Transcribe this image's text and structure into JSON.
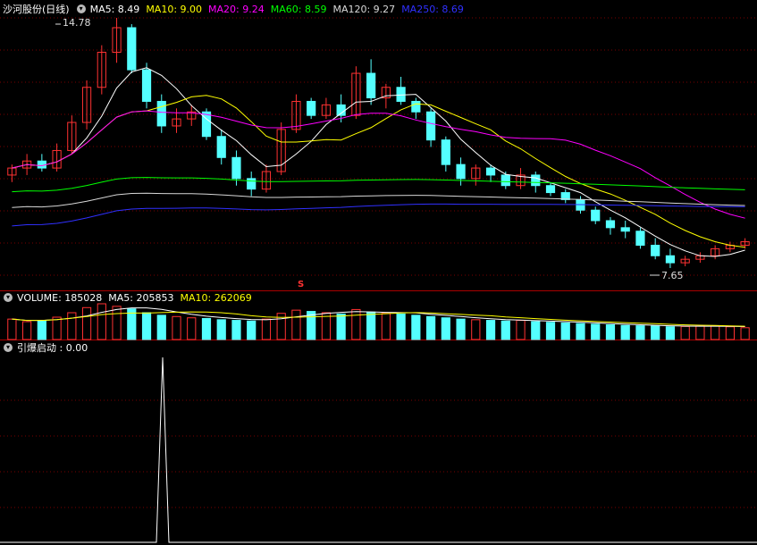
{
  "stock_title": "沙河股份(日线)",
  "ma_legend": [
    {
      "label": "MA5: 8.49",
      "color": "#ffffff"
    },
    {
      "label": "MA10: 9.00",
      "color": "#ffff00"
    },
    {
      "label": "MA20: 9.24",
      "color": "#ff00ff"
    },
    {
      "label": "MA60: 8.59",
      "color": "#00ff00"
    },
    {
      "label": "MA120: 9.27",
      "color": "#d8d8d8"
    },
    {
      "label": "MA250: 8.69",
      "color": "#3030ff"
    }
  ],
  "volume_legend": {
    "volume": "VOLUME: 185028",
    "ma5": "MA5: 205853",
    "ma10": "MA10: 262069",
    "ma5_color": "#ffffff",
    "ma10_color": "#ffff00"
  },
  "indicator_legend": {
    "label": "引爆启动 : 0.00"
  },
  "high_label": "14.78",
  "low_label": "7.65",
  "marker_symbol": "S",
  "expand_icon": "chevron-down-icon",
  "colors": {
    "up": "#ff3232",
    "down": "#54ffff",
    "grid": "#7a0000",
    "axis": "#aa0000"
  },
  "chart_data": {
    "type": "candlestick",
    "price_max": 14.78,
    "price_min": 7.65,
    "candles": [
      [
        10.3,
        10.6,
        10.1,
        10.5
      ],
      [
        10.5,
        10.9,
        10.3,
        10.7
      ],
      [
        10.7,
        10.9,
        10.4,
        10.5
      ],
      [
        10.5,
        11.2,
        10.4,
        11.0
      ],
      [
        11.0,
        12.0,
        10.9,
        11.8
      ],
      [
        11.8,
        13.0,
        11.6,
        12.8
      ],
      [
        12.8,
        14.0,
        12.6,
        13.8
      ],
      [
        13.8,
        14.78,
        13.5,
        14.5
      ],
      [
        14.5,
        14.6,
        13.2,
        13.3
      ],
      [
        13.3,
        13.5,
        12.2,
        12.4
      ],
      [
        12.4,
        12.6,
        11.5,
        11.7
      ],
      [
        11.7,
        12.2,
        11.5,
        11.9
      ],
      [
        11.9,
        12.3,
        11.7,
        12.1
      ],
      [
        12.1,
        12.2,
        11.3,
        11.4
      ],
      [
        11.4,
        11.6,
        10.6,
        10.8
      ],
      [
        10.8,
        11.0,
        10.0,
        10.2
      ],
      [
        10.2,
        10.4,
        9.7,
        9.9
      ],
      [
        9.9,
        10.6,
        9.8,
        10.4
      ],
      [
        10.4,
        11.8,
        10.3,
        11.6
      ],
      [
        11.6,
        12.6,
        11.5,
        12.4
      ],
      [
        12.4,
        12.5,
        11.9,
        12.0
      ],
      [
        12.0,
        12.5,
        11.9,
        12.3
      ],
      [
        12.3,
        12.6,
        11.8,
        12.0
      ],
      [
        12.0,
        13.4,
        11.9,
        13.2
      ],
      [
        13.2,
        13.6,
        12.3,
        12.5
      ],
      [
        12.5,
        12.9,
        12.2,
        12.8
      ],
      [
        12.8,
        13.1,
        12.3,
        12.4
      ],
      [
        12.4,
        12.5,
        11.9,
        12.1
      ],
      [
        12.1,
        12.2,
        11.1,
        11.3
      ],
      [
        11.3,
        11.4,
        10.4,
        10.6
      ],
      [
        10.6,
        10.8,
        10.0,
        10.2
      ],
      [
        10.2,
        10.6,
        10.0,
        10.5
      ],
      [
        10.5,
        10.6,
        10.1,
        10.3
      ],
      [
        10.3,
        10.4,
        9.9,
        10.0
      ],
      [
        10.0,
        10.5,
        9.9,
        10.3
      ],
      [
        10.3,
        10.4,
        9.8,
        10.0
      ],
      [
        10.0,
        10.1,
        9.7,
        9.8
      ],
      [
        9.8,
        9.9,
        9.5,
        9.6
      ],
      [
        9.6,
        9.7,
        9.2,
        9.3
      ],
      [
        9.3,
        9.4,
        8.9,
        9.0
      ],
      [
        9.0,
        9.1,
        8.6,
        8.8
      ],
      [
        8.8,
        9.0,
        8.5,
        8.7
      ],
      [
        8.7,
        8.8,
        8.2,
        8.3
      ],
      [
        8.3,
        8.5,
        7.9,
        8.0
      ],
      [
        8.0,
        8.2,
        7.65,
        7.8
      ],
      [
        7.8,
        8.0,
        7.7,
        7.9
      ],
      [
        7.9,
        8.1,
        7.8,
        8.0
      ],
      [
        8.0,
        8.3,
        7.9,
        8.2
      ],
      [
        8.2,
        8.4,
        8.1,
        8.3
      ],
      [
        8.3,
        8.5,
        8.2,
        8.4
      ]
    ],
    "volume": [
      320,
      280,
      300,
      350,
      420,
      500,
      560,
      520,
      480,
      420,
      380,
      360,
      340,
      330,
      310,
      300,
      290,
      320,
      410,
      460,
      440,
      420,
      400,
      470,
      430,
      410,
      400,
      380,
      360,
      340,
      320,
      310,
      300,
      290,
      300,
      280,
      270,
      260,
      250,
      240,
      230,
      220,
      215,
      210,
      200,
      205,
      210,
      215,
      200,
      185
    ]
  }
}
